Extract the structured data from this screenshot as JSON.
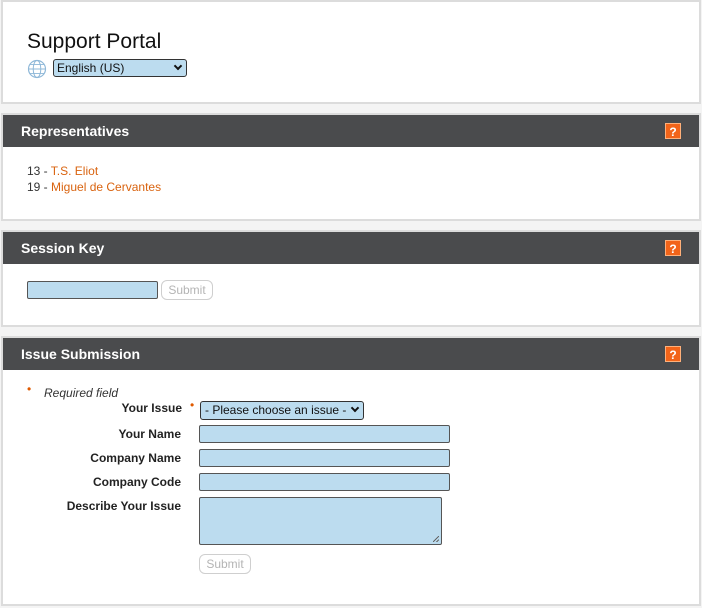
{
  "header": {
    "title": "Support Portal",
    "language": {
      "selected": "English (US)"
    },
    "globe_icon": "globe-icon"
  },
  "representatives": {
    "title": "Representatives",
    "help_label": "?",
    "items": [
      {
        "id": "13 - ",
        "name": "T.S. Eliot"
      },
      {
        "id": "19 - ",
        "name": "Miguel de Cervantes"
      }
    ]
  },
  "session_key": {
    "title": "Session Key",
    "help_label": "?",
    "input_value": "",
    "submit_label": "Submit"
  },
  "issue_submission": {
    "title": "Issue Submission",
    "help_label": "?",
    "required_marker": "•",
    "required_text": "Required field",
    "fields": {
      "issue": {
        "label": "Your Issue",
        "selected": "- Please choose an issue -"
      },
      "name": {
        "label": "Your Name",
        "value": ""
      },
      "company_name": {
        "label": "Company Name",
        "value": ""
      },
      "company_code": {
        "label": "Company Code",
        "value": ""
      },
      "describe": {
        "label": "Describe Your Issue",
        "value": ""
      }
    },
    "submit_label": "Submit"
  },
  "colors": {
    "accent": "#d9630f",
    "help_bg": "#f26419",
    "header_bar": "#4a4b4d",
    "input_bg": "#bcdcef"
  }
}
